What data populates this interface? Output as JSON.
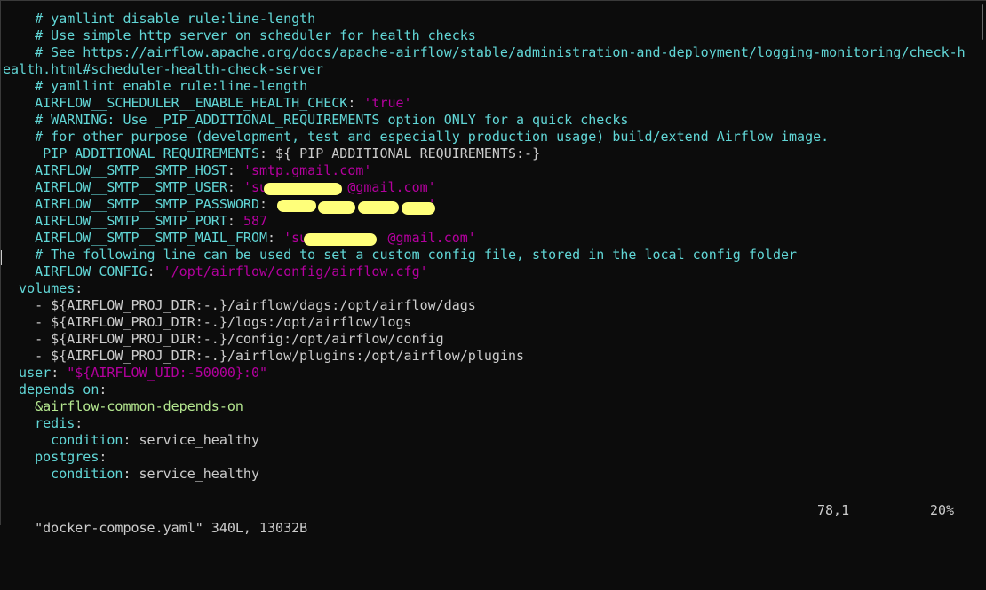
{
  "editor": {
    "lines": [
      [
        {
          "t": "    # yamllint disable rule:line-length",
          "c": "cm"
        }
      ],
      [
        {
          "t": "    # Use simple http server on scheduler for health checks",
          "c": "cm"
        }
      ],
      [
        {
          "t": "    # See https://airflow.apache.org/docs/apache-airflow/stable/administration-and-deployment/logging-monitoring/check-h",
          "c": "cm"
        }
      ],
      [
        {
          "t": "ealth.html#scheduler-health-check-server",
          "c": "cm"
        }
      ],
      [
        {
          "t": "    # yamllint enable rule:line-length",
          "c": "cm"
        }
      ],
      [
        {
          "t": "    AIRFLOW__SCHEDULER__ENABLE_HEALTH_CHECK",
          "c": "key"
        },
        {
          "t": ": ",
          "c": "plain"
        },
        {
          "t": "'true'",
          "c": "str"
        }
      ],
      [
        {
          "t": "    # WARNING: Use _PIP_ADDITIONAL_REQUIREMENTS option ONLY for a quick checks",
          "c": "cm"
        }
      ],
      [
        {
          "t": "    # for other purpose (development, test and especially production usage) build/extend Airflow image.",
          "c": "cm"
        }
      ],
      [
        {
          "t": "    _PIP_ADDITIONAL_REQUIREMENTS",
          "c": "key"
        },
        {
          "t": ": ${_PIP_ADDITIONAL_REQUIREMENTS:-}",
          "c": "plain"
        }
      ],
      [
        {
          "t": "    AIRFLOW__SMTP__SMTP_HOST",
          "c": "key"
        },
        {
          "t": ": ",
          "c": "plain"
        },
        {
          "t": "'smtp.gmail.com'",
          "c": "str"
        }
      ],
      [
        {
          "t": "    AIRFLOW__SMTP__SMTP_USER",
          "c": "key"
        },
        {
          "t": ": ",
          "c": "plain"
        },
        {
          "t": "'su          @gmail.com'",
          "c": "str"
        }
      ],
      [
        {
          "t": "    AIRFLOW__SMTP__SMTP_PASSWORD",
          "c": "key"
        },
        {
          "t": ": ",
          "c": "plain"
        },
        {
          "t": "                   '",
          "c": "str"
        }
      ],
      [
        {
          "t": "    AIRFLOW__SMTP__SMTP_PORT",
          "c": "key"
        },
        {
          "t": ": ",
          "c": "plain"
        },
        {
          "t": "587",
          "c": "str"
        }
      ],
      [
        {
          "t": "    AIRFLOW__SMTP__SMTP_MAIL_FROM",
          "c": "key"
        },
        {
          "t": ": ",
          "c": "plain"
        },
        {
          "t": "'su          @gmail.com'",
          "c": "str"
        }
      ],
      [
        {
          "t": "    # The following line can be used to set a custom config file, stored in the local config folder",
          "c": "cm"
        }
      ],
      [
        {
          "t": "    AIRFLOW_CONFIG",
          "c": "key"
        },
        {
          "t": ": ",
          "c": "plain"
        },
        {
          "t": "'/opt/airflow/config/airflow.cfg'",
          "c": "str"
        }
      ],
      [
        {
          "t": "  volumes",
          "c": "key"
        },
        {
          "t": ":",
          "c": "plain"
        }
      ],
      [
        {
          "t": "    - ${AIRFLOW_PROJ_DIR:-.}/airflow/dags:/opt/airflow/dags",
          "c": "plain"
        }
      ],
      [
        {
          "t": "    - ${AIRFLOW_PROJ_DIR:-.}/logs:/opt/airflow/logs",
          "c": "plain"
        }
      ],
      [
        {
          "t": "    - ${AIRFLOW_PROJ_DIR:-.}/config:/opt/airflow/config",
          "c": "plain"
        }
      ],
      [
        {
          "t": "    - ${AIRFLOW_PROJ_DIR:-.}/airflow/plugins:/opt/airflow/plugins",
          "c": "plain"
        }
      ],
      [
        {
          "t": "  user",
          "c": "key"
        },
        {
          "t": ": ",
          "c": "plain"
        },
        {
          "t": "\"${AIRFLOW_UID:-50000}:0\"",
          "c": "str"
        }
      ],
      [
        {
          "t": "  depends_on",
          "c": "key"
        },
        {
          "t": ":",
          "c": "plain"
        }
      ],
      [
        {
          "t": "    &airflow-common-depends-on",
          "c": "anchor"
        }
      ],
      [
        {
          "t": "    redis",
          "c": "key"
        },
        {
          "t": ":",
          "c": "plain"
        }
      ],
      [
        {
          "t": "      condition",
          "c": "key"
        },
        {
          "t": ": service_healthy",
          "c": "plain"
        }
      ],
      [
        {
          "t": "    postgres",
          "c": "key"
        },
        {
          "t": ":",
          "c": "plain"
        }
      ],
      [
        {
          "t": "      condition",
          "c": "key"
        },
        {
          "t": ": service_healthy",
          "c": "plain"
        }
      ]
    ]
  },
  "status": {
    "file": "\"docker-compose.yaml\" 340L, 13032B",
    "position": "78,1",
    "percent": "20%"
  },
  "colors": {
    "background": "#0c0c0c",
    "comment": "#61d6d6",
    "key": "#61d6d6",
    "string": "#b4009e",
    "anchor": "#b5e890",
    "text": "#cccccc",
    "redaction": "#ffff7a"
  }
}
